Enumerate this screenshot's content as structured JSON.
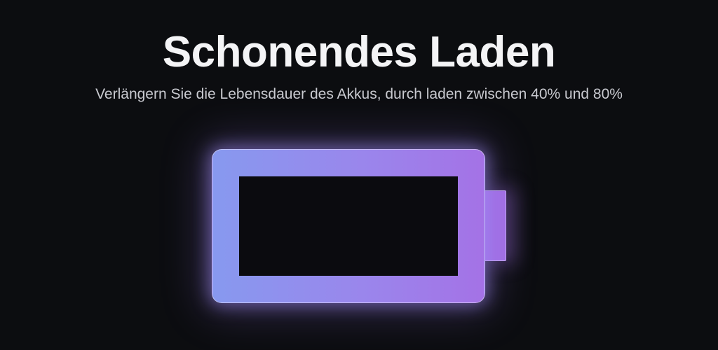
{
  "header": {
    "title": "Schonendes Laden",
    "subtitle": "Verlängern Sie die Lebensdauer des Akkus, durch laden zwischen 40% und 80%"
  },
  "battery": {
    "icon": "battery-icon",
    "colors": {
      "gradient_start": "#8799ef",
      "gradient_end": "#a472e6",
      "background": "#0c0d10"
    }
  }
}
